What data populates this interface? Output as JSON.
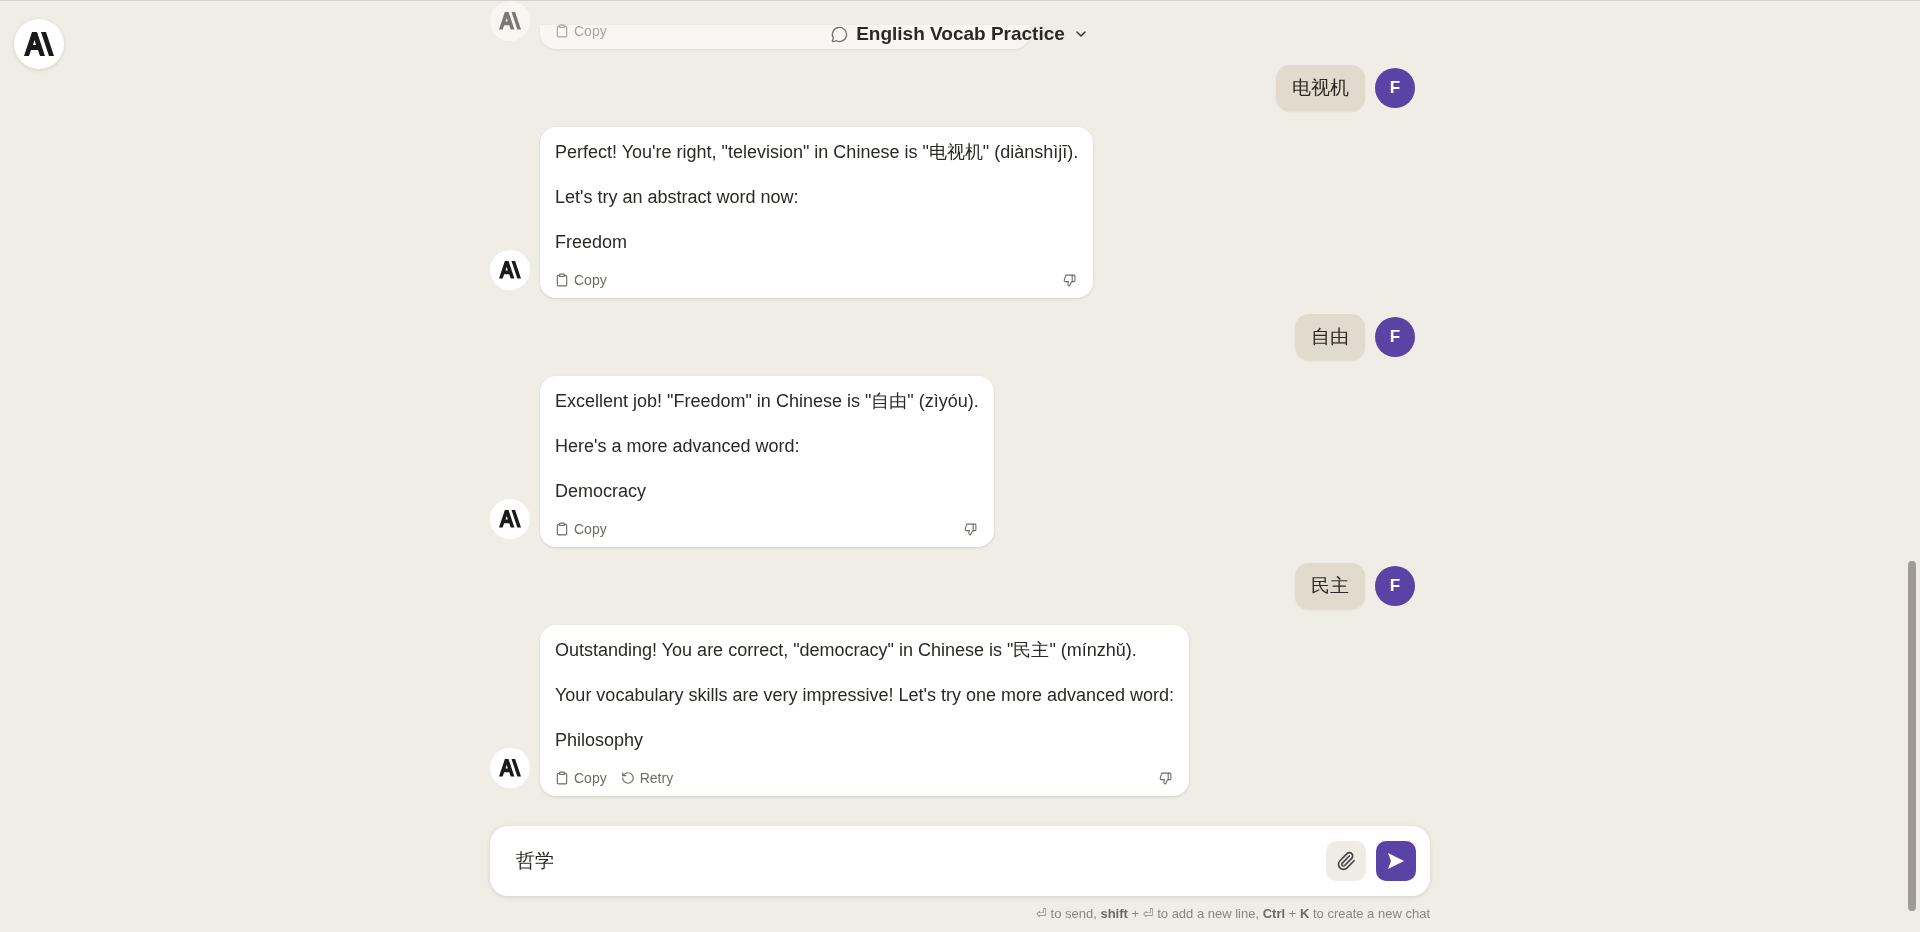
{
  "header": {
    "title": "English Vocab Practice"
  },
  "messages": [
    {
      "kind": "assistant_partial",
      "actions": [
        {
          "kind": "copy",
          "label": "Copy"
        }
      ]
    },
    {
      "kind": "user",
      "avatar": "F",
      "text": "电视机"
    },
    {
      "kind": "assistant",
      "paragraphs": [
        "Perfect! You're right, \"television\" in Chinese is \"电视机\" (diànshìjī).",
        "Let's try an abstract word now:",
        "Freedom"
      ],
      "actions": [
        {
          "kind": "copy",
          "label": "Copy"
        }
      ]
    },
    {
      "kind": "user",
      "avatar": "F",
      "text": "自由"
    },
    {
      "kind": "assistant",
      "paragraphs": [
        "Excellent job! \"Freedom\" in Chinese is \"自由\" (zìyóu).",
        "Here's a more advanced word:",
        "Democracy"
      ],
      "actions": [
        {
          "kind": "copy",
          "label": "Copy"
        }
      ]
    },
    {
      "kind": "user",
      "avatar": "F",
      "text": "民主"
    },
    {
      "kind": "assistant",
      "paragraphs": [
        "Outstanding! You are correct, \"democracy\" in Chinese is \"民主\" (mínzhǔ).",
        "Your vocabulary skills are very impressive! Let's try one more advanced word:",
        "Philosophy"
      ],
      "actions": [
        {
          "kind": "copy",
          "label": "Copy"
        },
        {
          "kind": "retry",
          "label": "Retry"
        }
      ]
    }
  ],
  "composer": {
    "value": "哲学",
    "hint": "⏎ to send, **shift** + ⏎ to add a new line, **Ctrl** + **K** to create a new chat"
  }
}
